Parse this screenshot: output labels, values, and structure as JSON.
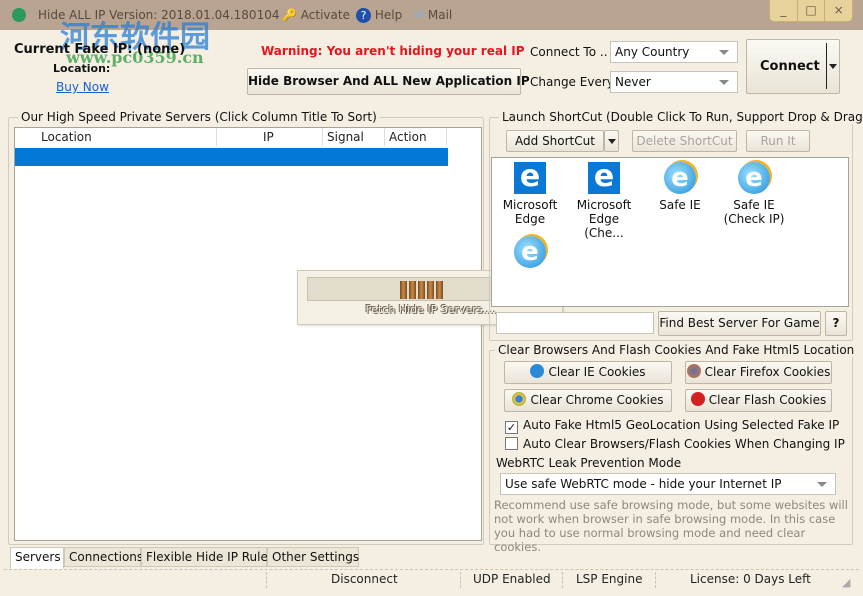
{
  "window": {
    "title": "Hide ALL IP  Version: 2018.01.04.180104",
    "activate": "Activate",
    "help": "Help",
    "mail": "Mail",
    "minimize": "_",
    "maximize": "□",
    "close": "×"
  },
  "watermark": {
    "cn": "河东软件园",
    "url": "www.pc0359.cn"
  },
  "header": {
    "current_ip": "Current Fake IP: (none)",
    "location": "Location:",
    "buy_now": "Buy Now",
    "warning": "Warning: You aren't hiding your real IP",
    "hide_button": "Hide Browser And ALL New Application IP",
    "connect_to_label": "Connect To ..",
    "connect_to_value": "Any Country",
    "change_every_label": "Change Every",
    "change_every_value": "Never",
    "connect_button": "Connect"
  },
  "servers": {
    "title": "Our High Speed Private Servers (Click Column Title To Sort)",
    "columns": [
      "Location",
      "IP",
      "Signal",
      "Action"
    ],
    "progress_text": "Fetch Hide IP Servers....",
    "progress_blocks": 5
  },
  "shortcuts": {
    "title": "Launch ShortCut (Double Click To Run, Support Drop & Drag)",
    "add": "Add ShortCut",
    "delete": "Delete ShortCut",
    "run": "Run It",
    "items": [
      {
        "label": "Microsoft Edge",
        "icon": "edge-icon"
      },
      {
        "label": "Microsoft Edge (Che...",
        "icon": "edge-icon"
      },
      {
        "label": "Safe IE",
        "icon": "ie-icon"
      },
      {
        "label": "Safe IE (Check IP)",
        "icon": "ie-icon"
      },
      {
        "label": "",
        "icon": "ie-icon"
      }
    ],
    "find_game_input": "",
    "find_game": "Find Best Server For Game",
    "help": "?"
  },
  "cookies": {
    "title": "Clear Browsers And Flash Cookies And Fake Html5 Location",
    "clear_ie": "Clear IE Cookies",
    "clear_firefox": "Clear Firefox Cookies",
    "clear_chrome": "Clear Chrome Cookies",
    "clear_flash": "Clear Flash Cookies",
    "auto_geo": "Auto Fake Html5 GeoLocation Using Selected Fake IP",
    "auto_geo_checked": true,
    "auto_clear": "Auto Clear Browsers/Flash Cookies When Changing IP",
    "auto_clear_checked": false,
    "webrtc_label": "WebRTC Leak Prevention Mode",
    "webrtc_value": "Use safe WebRTC mode - hide your Internet IP",
    "note": "Recommend use safe browsing mode, but some websites will not work when browser in safe browsing mode. In this case you had to use normal browsing mode and need clear cookies."
  },
  "tabs": [
    "Servers",
    "Connections",
    "Flexible Hide IP Rules",
    "Other Settings"
  ],
  "status": {
    "connection": "Disconnect",
    "udp": "UDP Enabled",
    "engine": "LSP Engine",
    "license": "License: 0 Days Left"
  },
  "colors": {
    "warning": "#e8141e",
    "link": "#1a5fd0",
    "selection": "#0078d7",
    "titlebar": "#b9a391"
  }
}
